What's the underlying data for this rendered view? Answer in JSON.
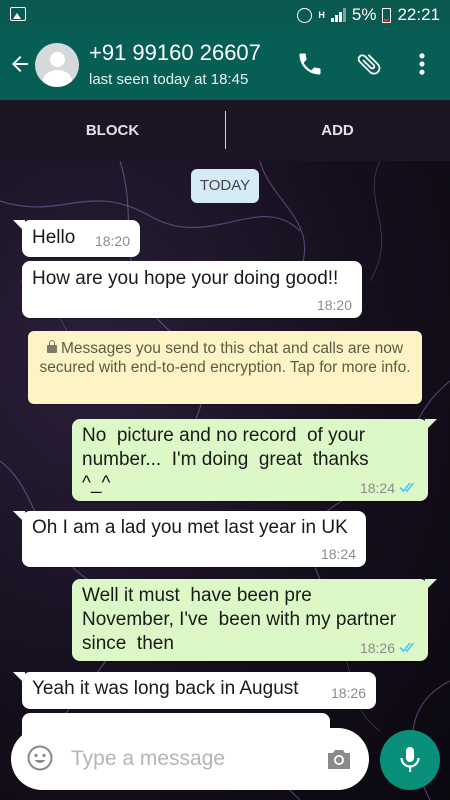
{
  "status_bar": {
    "battery": "5%",
    "time": "22:21",
    "network": "H"
  },
  "header": {
    "contact_name": "+91 99160 26607",
    "last_seen": "last seen today at 18:45"
  },
  "action_bar": {
    "block_label": "BLOCK",
    "add_label": "ADD"
  },
  "date_chip": "TODAY",
  "encryption_notice": "Messages you send to this chat and calls are now secured with end-to-end encryption. Tap for more info.",
  "messages": [
    {
      "direction": "in",
      "text": "Hello",
      "time": "18:20"
    },
    {
      "direction": "in",
      "text": "How are you hope your doing good!!",
      "time": "18:20"
    },
    {
      "direction": "out",
      "text": "No  picture and no record  of your\nnumber...  I'm doing  great  thanks\n^_^",
      "time": "18:24",
      "status": "read"
    },
    {
      "direction": "in",
      "text": "Oh I am a lad you met last year in UK",
      "time": "18:24"
    },
    {
      "direction": "out",
      "text": "Well it must  have been pre\nNovember, I've  been with my partner\nsince  then",
      "time": "18:26",
      "status": "read"
    },
    {
      "direction": "in",
      "text": "Yeah it was long back in August",
      "time": "18:26"
    }
  ],
  "composer": {
    "placeholder": "Type a message"
  },
  "colors": {
    "header": "#075e54",
    "status_bar": "#0a5a4f",
    "outgoing_bubble": "#dcf8c6",
    "incoming_bubble": "#ffffff",
    "read_ticks": "#4fc3f7",
    "mic_button": "#0a8f7a"
  },
  "icons": [
    "gallery-icon",
    "alarm-icon",
    "signal-icon",
    "battery-icon",
    "back-arrow-icon",
    "avatar-icon",
    "phone-icon",
    "attach-icon",
    "more-vert-icon",
    "lock-icon",
    "double-tick-icon",
    "emoji-icon",
    "camera-icon",
    "mic-icon"
  ]
}
